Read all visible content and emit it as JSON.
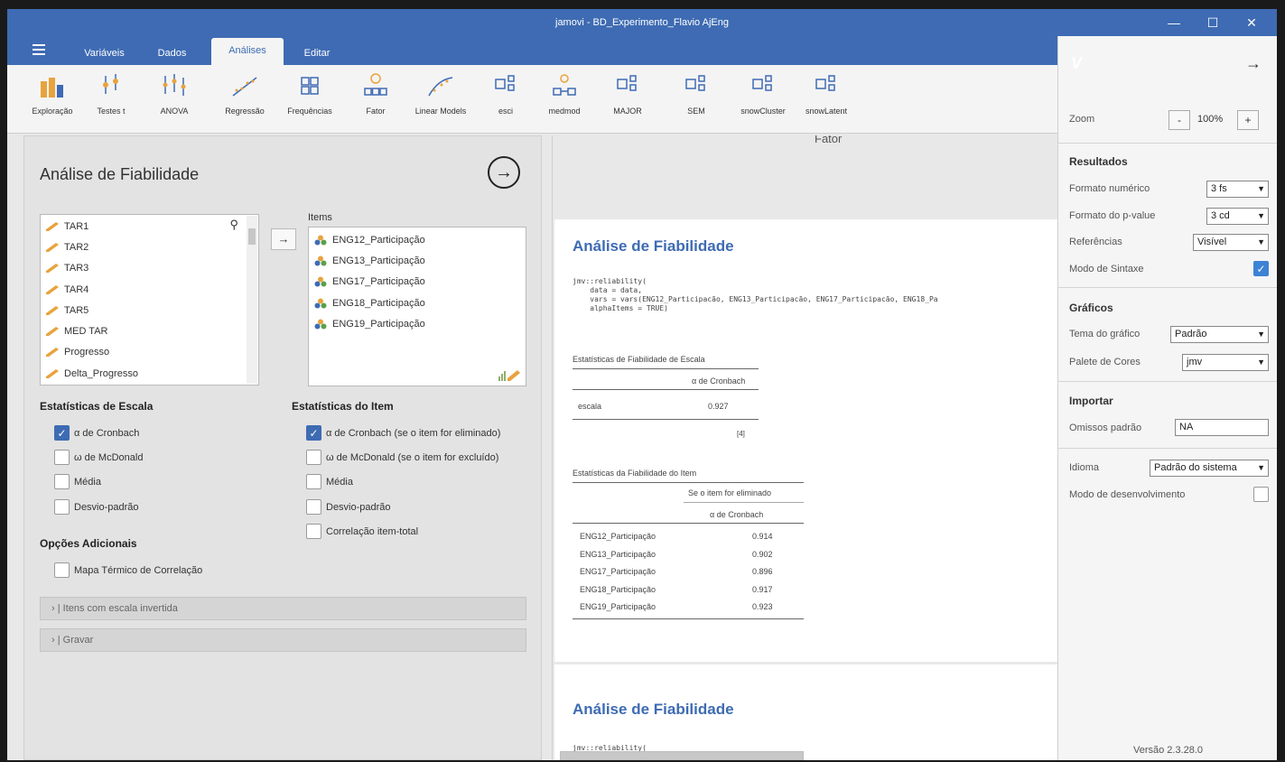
{
  "window": {
    "title": "jamovi - BD_Experimento_Flavio AjEng"
  },
  "tabs": [
    "Variáveis",
    "Dados",
    "Análises",
    "Editar"
  ],
  "active_tab": "Análises",
  "ribbon": [
    "Exploração",
    "Testes t",
    "ANOVA",
    "Regressão",
    "Frequências",
    "Fator",
    "Linear Models",
    "esci",
    "medmod",
    "MAJOR",
    "SEM",
    "snowCluster",
    "snowLatent"
  ],
  "options": {
    "title": "Análise de Fiabilidade",
    "variables": [
      "TAR1",
      "TAR2",
      "TAR3",
      "TAR4",
      "TAR5",
      "MED TAR",
      "Progresso",
      "Delta_Progresso"
    ],
    "items_label": "Items",
    "items": [
      "ENG12_Participação",
      "ENG13_Participação",
      "ENG17_Participação",
      "ENG18_Participação",
      "ENG19_Participação"
    ],
    "scale_stats_label": "Estatísticas de Escala",
    "scale_stats": [
      {
        "label": "α de Cronbach",
        "checked": true
      },
      {
        "label": "ω de McDonald",
        "checked": false
      },
      {
        "label": "Média",
        "checked": false
      },
      {
        "label": "Desvio-padrão",
        "checked": false
      }
    ],
    "item_stats_label": "Estatísticas do Item",
    "item_stats": [
      {
        "label": "α de Cronbach (se o item for eliminado)",
        "checked": true
      },
      {
        "label": "ω de McDonald (se o item for excluído)",
        "checked": false
      },
      {
        "label": "Média",
        "checked": false
      },
      {
        "label": "Desvio-padrão",
        "checked": false
      },
      {
        "label": "Correlação item-total",
        "checked": false
      }
    ],
    "extra_label": "Opções Adicionais",
    "heatmap_label": "Mapa Térmico de Correlação",
    "reverse_label": "Itens com escala invertida",
    "save_label": "Gravar"
  },
  "results": {
    "section_header": "Fator",
    "title": "Análise de Fiabilidade",
    "code": "jmv::reliability(\n    data = data,\n    vars = vars(ENG12_Participacão, ENG13_Participacão, ENG17_Participacão, ENG18_Pa\n    alphaItems = TRUE)",
    "scale_table": {
      "caption": "Estatísticas de Fiabilidade de Escala",
      "col": "α de Cronbach",
      "row_label": "escala",
      "value": "0.927",
      "footnote": "[4]"
    },
    "item_table": {
      "caption": "Estatísticas da Fiabilidade do Item",
      "group_header": "Se o item for eliminado",
      "col": "α de Cronbach",
      "rows": [
        {
          "item": "ENG12_Participação",
          "value": "0.914"
        },
        {
          "item": "ENG13_Participação",
          "value": "0.902"
        },
        {
          "item": "ENG17_Participação",
          "value": "0.896"
        },
        {
          "item": "ENG18_Participação",
          "value": "0.917"
        },
        {
          "item": "ENG19_Participação",
          "value": "0.923"
        }
      ]
    },
    "title2": "Análise de Fiabilidade",
    "code2_partial": "jmv::reliability("
  },
  "settings": {
    "zoom_label": "Zoom",
    "zoom_value": "100%",
    "results_header": "Resultados",
    "number_format_label": "Formato numérico",
    "number_format_value": "3 fs",
    "pvalue_format_label": "Formato do p-value",
    "pvalue_format_value": "3 cd",
    "references_label": "Referências",
    "references_value": "Visível",
    "syntax_mode_label": "Modo de Sintaxe",
    "syntax_mode": true,
    "graphics_header": "Gráficos",
    "theme_label": "Tema do gráfico",
    "theme_value": "Padrão",
    "palette_label": "Palete de Cores",
    "palette_value": "jmv",
    "import_header": "Importar",
    "missing_label": "Omissos padrão",
    "missing_value": "NA",
    "language_label": "Idioma",
    "language_value": "Padrão do sistema",
    "dev_mode_label": "Modo de desenvolvimento",
    "dev_mode": false,
    "version": "Versão 2.3.28.0"
  },
  "colors": {
    "brand": "#3e6bb3",
    "check": "#3e82d4",
    "result_title": "#3e6bb3"
  }
}
